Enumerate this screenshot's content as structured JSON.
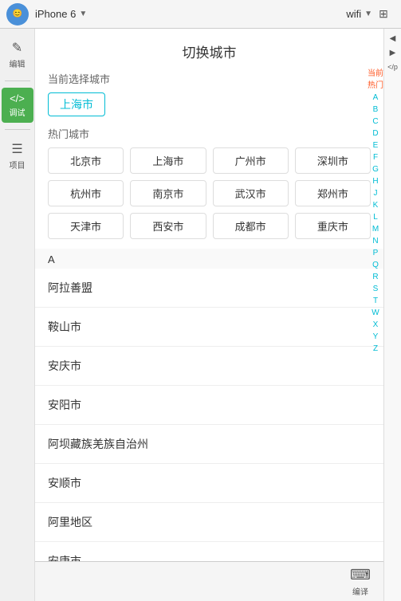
{
  "toolbar": {
    "device_label": "iPhone 6",
    "wifi_label": "wifi",
    "device_arrow": "▼",
    "wifi_arrow": "▼",
    "right_btn_label": "≡"
  },
  "sidebar": {
    "items": [
      {
        "id": "edit",
        "icon": "✏",
        "label": "编辑"
      },
      {
        "id": "debug",
        "icon": "</>",
        "label": "调试",
        "active": true
      },
      {
        "id": "project",
        "icon": "☰",
        "label": "项目"
      }
    ]
  },
  "right_panel": {
    "buttons": [
      "▶",
      "▶",
      "</p"
    ]
  },
  "page": {
    "title": "切换城市",
    "current_city_label": "当前选择城市",
    "current_city": "上海市",
    "hot_cities_label": "热门城市",
    "hot_cities": [
      "北京市",
      "上海市",
      "广州市",
      "深圳市",
      "杭州市",
      "南京市",
      "武汉市",
      "郑州市",
      "天津市",
      "西安市",
      "成都市",
      "重庆市"
    ],
    "alpha_index": [
      "当前",
      "热门",
      "A",
      "B",
      "C",
      "D",
      "E",
      "F",
      "G",
      "H",
      "J",
      "K",
      "L",
      "M",
      "N",
      "P",
      "Q",
      "R",
      "S",
      "T",
      "W",
      "X",
      "Y",
      "Z"
    ],
    "alpha_highlight": [
      "当前",
      "热门"
    ],
    "city_groups": [
      {
        "letter": "A",
        "cities": [
          "阿拉善盟",
          "鞍山市",
          "安庆市",
          "安阳市",
          "阿坝藏族羌族自治州",
          "安顺市",
          "阿里地区",
          "安康市"
        ]
      }
    ]
  },
  "bottom": {
    "items": [
      {
        "id": "translate",
        "icon": "🔤",
        "label": "编译"
      }
    ]
  }
}
